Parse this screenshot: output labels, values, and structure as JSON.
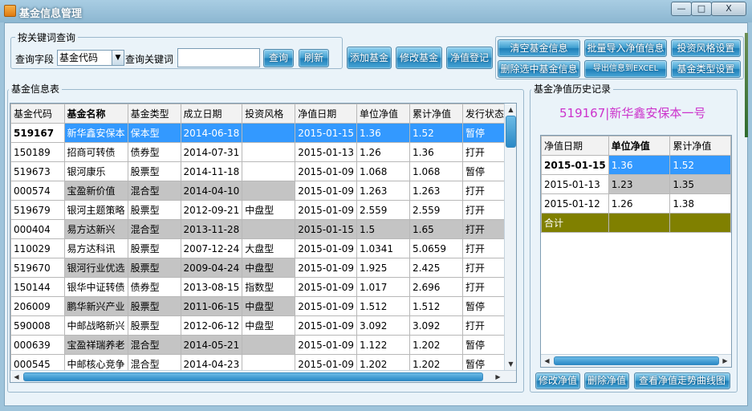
{
  "window": {
    "title": "基金信息管理",
    "controls": [
      "—",
      "□",
      "X"
    ]
  },
  "query": {
    "group_label": "按关键词查询",
    "field_label": "查询字段",
    "field_value": "基金代码",
    "keyword_label": "查询关键词",
    "keyword_value": "",
    "query_button": "查询",
    "refresh_button": "刷新"
  },
  "actions": {
    "add": "添加基金",
    "edit": "修改基金",
    "nav_register": "净值登记",
    "clear_info": "清空基金信息",
    "delete_selected": "删除选中基金信息",
    "batch_import": "批量导入净值信息",
    "export_excel": "导出信息到EXCEL",
    "style_settings": "投资风格设置",
    "type_settings": "基金类型设置"
  },
  "fund_table": {
    "label": "基金信息表",
    "columns": [
      "基金代码",
      "基金名称",
      "基金类型",
      "成立日期",
      "投资风格",
      "净值日期",
      "单位净值",
      "累计净值",
      "发行状态"
    ],
    "rows": [
      [
        "519167",
        "新华鑫安保本",
        "保本型",
        "2014-06-18",
        "",
        "2015-01-15",
        "1.36",
        "1.52",
        "暂停"
      ],
      [
        "150189",
        "招商可转债",
        "债券型",
        "2014-07-31",
        "",
        "2015-01-13",
        "1.26",
        "1.36",
        "打开"
      ],
      [
        "519673",
        "银河康乐",
        "股票型",
        "2014-11-18",
        "",
        "2015-01-09",
        "1.068",
        "1.068",
        "暂停"
      ],
      [
        "000574",
        "宝盈新价值",
        "混合型",
        "2014-04-10",
        "",
        "2015-01-09",
        "1.263",
        "1.263",
        "打开"
      ],
      [
        "519679",
        "银河主题策略",
        "股票型",
        "2012-09-21",
        "中盘型",
        "2015-01-09",
        "2.559",
        "2.559",
        "打开"
      ],
      [
        "000404",
        "易方达新兴",
        "混合型",
        "2013-11-28",
        "",
        "2015-01-15",
        "1.5",
        "1.65",
        "打开"
      ],
      [
        "110029",
        "易方达科讯",
        "股票型",
        "2007-12-24",
        "大盘型",
        "2015-01-09",
        "1.0341",
        "5.0659",
        "打开"
      ],
      [
        "519670",
        "银河行业优选",
        "股票型",
        "2009-04-24",
        "中盘型",
        "2015-01-09",
        "1.925",
        "2.425",
        "打开"
      ],
      [
        "150144",
        "银华中证转债",
        "债券型",
        "2013-08-15",
        "指数型",
        "2015-01-09",
        "1.017",
        "2.696",
        "打开"
      ],
      [
        "206009",
        "鹏华新兴产业",
        "股票型",
        "2011-06-15",
        "中盘型",
        "2015-01-09",
        "1.512",
        "1.512",
        "暂停"
      ],
      [
        "590008",
        "中邮战略新兴",
        "股票型",
        "2012-06-12",
        "中盘型",
        "2015-01-09",
        "3.092",
        "3.092",
        "打开"
      ],
      [
        "000639",
        "宝盈祥瑞养老",
        "混合型",
        "2014-05-21",
        "",
        "2015-01-09",
        "1.122",
        "1.202",
        "暂停"
      ],
      [
        "000545",
        "中邮核心竞争",
        "混合型",
        "2014-04-23",
        "",
        "2015-01-09",
        "1.202",
        "1.202",
        "暂停"
      ]
    ]
  },
  "history": {
    "label": "基金净值历史记录",
    "fund_title": "519167|新华鑫安保本一号",
    "columns": [
      "净值日期",
      "单位净值",
      "累计净值"
    ],
    "rows": [
      [
        "2015-01-15",
        "1.36",
        "1.52"
      ],
      [
        "2015-01-13",
        "1.23",
        "1.35"
      ],
      [
        "2015-01-12",
        "1.26",
        "1.38"
      ]
    ],
    "total_label": "合计",
    "edit_button": "修改净值",
    "delete_button": "删除净值",
    "chart_button": "查看净值走势曲线图"
  },
  "colors": {
    "selection": "#3399ff",
    "gray_row": "#c4c4c4",
    "total_row": "#808000",
    "fund_title": "#cc33cc",
    "button": "#2a89c6"
  }
}
